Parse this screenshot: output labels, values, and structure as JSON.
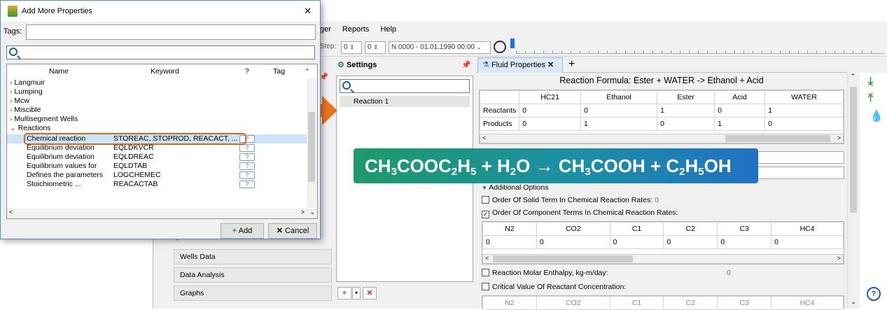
{
  "dialog": {
    "title": "Add More Properties",
    "tags_label": "Tags:",
    "columns": [
      "Name",
      "Keyword",
      "?",
      "Tag"
    ],
    "tree": [
      {
        "label": "Langmuir",
        "indent": 0,
        "arrow": ">"
      },
      {
        "label": "Lumping",
        "indent": 0,
        "arrow": ">"
      },
      {
        "label": "Mcw",
        "indent": 0,
        "arrow": ">"
      },
      {
        "label": "Miscible",
        "indent": 0,
        "arrow": ">"
      },
      {
        "label": "Multisegment Wells",
        "indent": 0,
        "arrow": ">"
      },
      {
        "label": "Reactions",
        "indent": 0,
        "arrow": "v"
      }
    ],
    "reaction_rows": [
      {
        "name": "Chemical reaction",
        "keyword": "STOREAC, STOPROD, REACACT, ...",
        "selected": true
      },
      {
        "name": "Equilibrium deviation",
        "keyword": "EQLDKVCR"
      },
      {
        "name": "Equilibrium deviation",
        "keyword": "EQLDREAC"
      },
      {
        "name": "Equilibrium values for",
        "keyword": "EQLDTAB"
      },
      {
        "name": "Defines the parameters",
        "keyword": "LOGCHEMEC"
      },
      {
        "name": "Stoichiometric ...",
        "keyword": "REACACTAB"
      }
    ],
    "add_label": "Add",
    "cancel_label": "Cancel"
  },
  "menu": [
    "ger",
    "Reports",
    "Help"
  ],
  "toolbar": {
    "step_label": "Step:",
    "step_a": "0",
    "step_b": "0",
    "date": "N 0000 - 01.01.1990 00:00"
  },
  "left_panel": [
    "Wells Data",
    "Data Analysis",
    "Graphs"
  ],
  "settings": {
    "title": "Settings",
    "items": [
      "Reaction 1"
    ]
  },
  "fluid": {
    "tab_label": "Fluid Properties",
    "formula": "Reaction Formula: Ester + WATER -> Ethanol + Acid",
    "columns": [
      "",
      "HC21",
      "Ethanol",
      "Ester",
      "Acid",
      "WATER"
    ],
    "rows": [
      {
        "label": "Reactants",
        "values": [
          "0",
          "0",
          "1",
          "0",
          "1"
        ]
      },
      {
        "label": "Products",
        "values": [
          "0",
          "1",
          "0",
          "1",
          "0"
        ]
      }
    ],
    "additional_options": "Additional Options",
    "solid_order": "Order Of Solid Term In Chemical Reaction Rates:",
    "solid_order_value": "0",
    "component_order": "Order Of Component Terms In Chemical Reaction Rates:",
    "comp_columns": [
      "N2",
      "CO2",
      "C1",
      "C2",
      "C3",
      "HC4"
    ],
    "comp_values": [
      "0",
      "0",
      "0",
      "0",
      "0",
      "0"
    ],
    "enthalpy": "Reaction Molar Enthalpy, kg-m/day:",
    "enthalpy_value": "0",
    "critical": "Critical Value Of Reactant Concentration:",
    "crit_columns": [
      "N2",
      "CO2",
      "C1",
      "C2",
      "C3",
      "HC4"
    ]
  },
  "banner": {
    "p1": "CH",
    "s1": "3",
    "p2": "COOC",
    "s2": "2",
    "p3": "H",
    "s3": "5",
    "p4": " + H",
    "s4": "2",
    "p5": "O → CH",
    "s5": "3",
    "p6": "COOH + C",
    "s6": "2",
    "p7": "H",
    "s7": "5",
    "p8": "OH"
  },
  "colors": {
    "accent": "#1a5fb4",
    "selection": "#cce4f7",
    "highlight_border": "#d2691e",
    "arrow": "#e8731e",
    "banner_start": "#1e9a6a",
    "banner_end": "#2171c2"
  }
}
